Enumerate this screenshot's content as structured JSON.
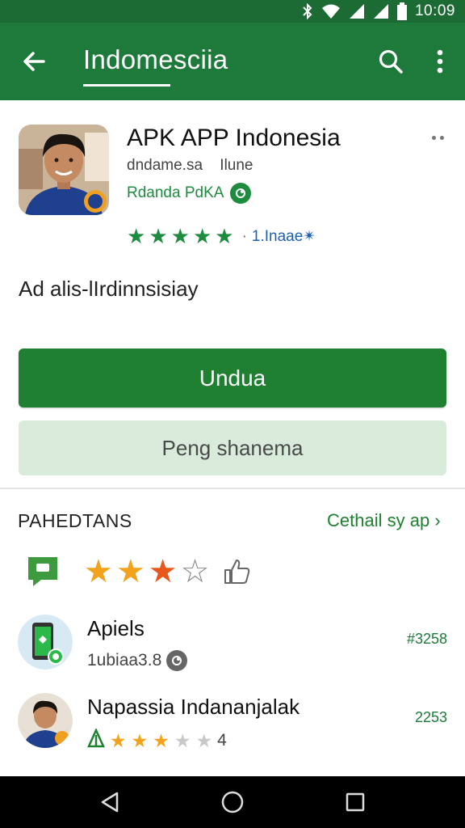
{
  "status_bar": {
    "time": "10:09",
    "icons": [
      "bluetooth-icon",
      "wifi-icon",
      "signal-icon",
      "signal-icon",
      "battery-icon"
    ]
  },
  "app_bar": {
    "title": "Indomesciia",
    "icons": [
      "back-arrow-icon",
      "search-icon",
      "more-vert-icon"
    ]
  },
  "app": {
    "name": "APK APP Indonesia",
    "developer": "dndame.sa",
    "developer_extra": "Ilune",
    "publisher": "Rdanda PdKA",
    "stars": 5,
    "rating_count": "1.Inaae✴",
    "description": "Ad alis-lIrdinnsisiay"
  },
  "buttons": {
    "install": "Undua",
    "secondary": "Peng shanema"
  },
  "reviews": {
    "title": "PAHEDTANS",
    "link": "Cethail sy ap",
    "summary_stars": [
      {
        "fill": "full",
        "color": "#f2a21b"
      },
      {
        "fill": "full",
        "color": "#f2a21b"
      },
      {
        "fill": "full",
        "color": "#e8581c"
      },
      {
        "fill": "empty",
        "color": "#888888"
      }
    ],
    "items": [
      {
        "name": "Apiels",
        "sub": "1ubiaa3.8",
        "count": "#3258"
      },
      {
        "name": "Napassia Indananjalak",
        "sub": "4",
        "count": "2253",
        "stars": 3
      }
    ]
  },
  "colors": {
    "brand": "#1e7a3a",
    "accent": "#1e8030",
    "link": "#1d5fb0"
  },
  "nav_bar": {
    "icons": [
      "back-triangle-icon",
      "home-circle-icon",
      "recents-square-icon"
    ]
  }
}
